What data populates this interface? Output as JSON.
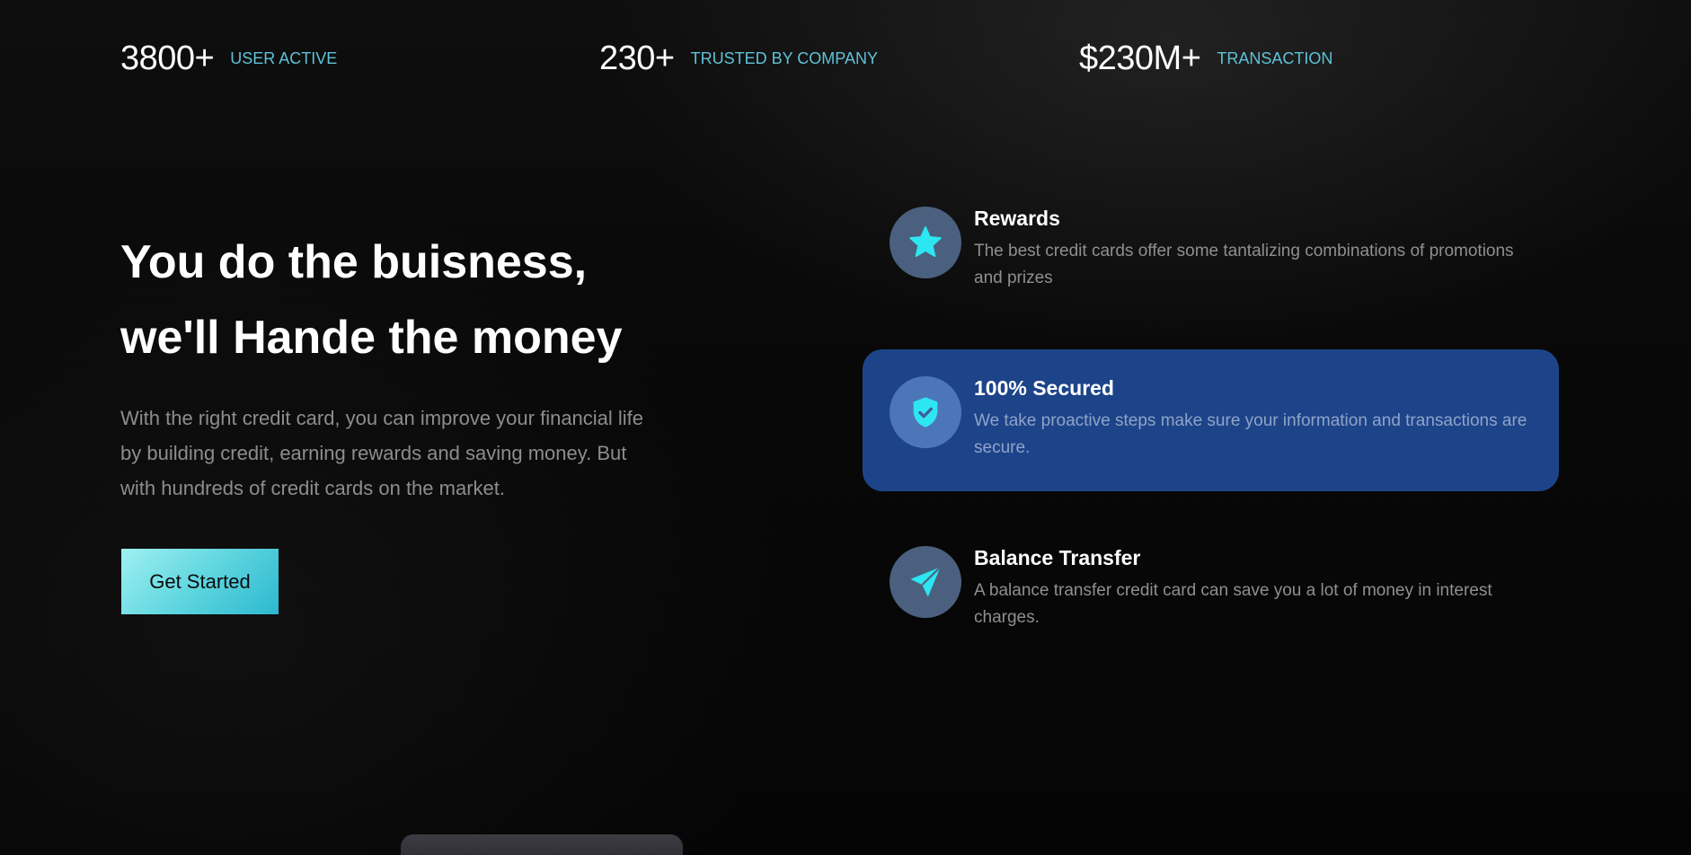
{
  "stats": [
    {
      "value": "3800+",
      "label": "USER ACTIVE"
    },
    {
      "value": "230+",
      "label": "TRUSTED BY COMPANY"
    },
    {
      "value": "$230M+",
      "label": "TRANSACTION"
    }
  ],
  "hero": {
    "title_line1": "You do the buisness,",
    "title_line2": "we'll Hande the money",
    "description": "With the right credit card, you can improve your financial life by building credit, earning rewards and saving money. But with hundreds of credit cards on the market.",
    "cta_label": "Get Started"
  },
  "features": [
    {
      "title": "Rewards",
      "description": "The best credit cards offer some tantalizing combinations of promotions and prizes",
      "icon": "star-icon",
      "active": false
    },
    {
      "title": "100% Secured",
      "description": "We take proactive steps make sure your information and transactions are secure.",
      "icon": "shield-check-icon",
      "active": true
    },
    {
      "title": "Balance Transfer",
      "description": "A balance transfer credit card can save you a lot of money in interest charges.",
      "icon": "send-icon",
      "active": false
    }
  ],
  "colors": {
    "accent": "#5fc2d8",
    "icon_accent": "#2ee6f2",
    "active_card": "#1d4489",
    "background": "#060606"
  }
}
